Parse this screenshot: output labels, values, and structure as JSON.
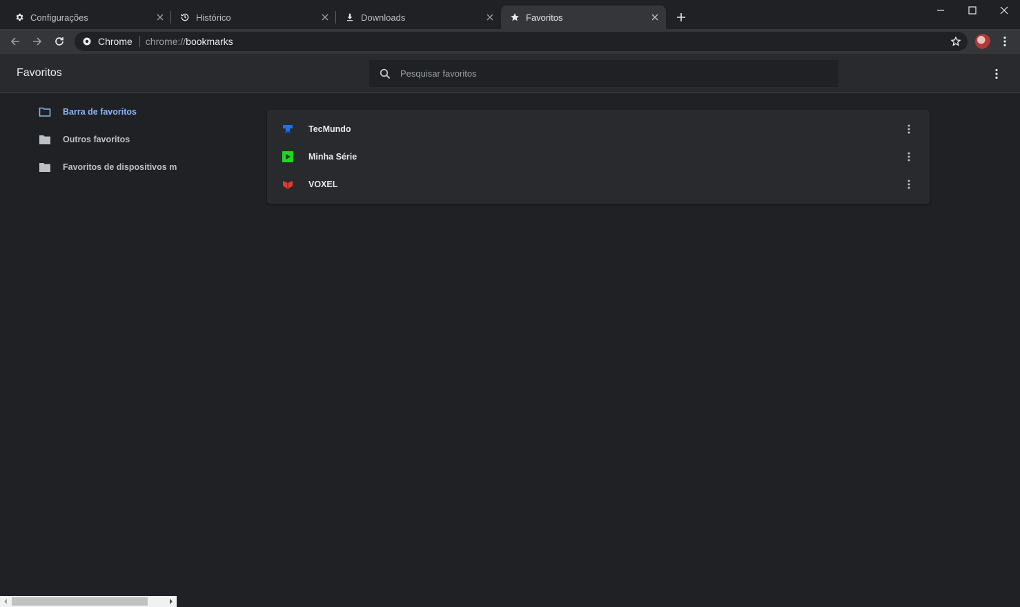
{
  "tabs": [
    {
      "title": "Configurações",
      "icon": "gear-icon",
      "active": false
    },
    {
      "title": "Histórico",
      "icon": "history-icon",
      "active": false
    },
    {
      "title": "Downloads",
      "icon": "download-icon",
      "active": false
    },
    {
      "title": "Favoritos",
      "icon": "star-icon",
      "active": true
    }
  ],
  "omnibox": {
    "site_label": "Chrome",
    "url_scheme": "chrome://",
    "url_host": "bookmarks"
  },
  "bookmarks_page": {
    "title": "Favoritos",
    "search_placeholder": "Pesquisar favoritos"
  },
  "sidebar": {
    "items": [
      {
        "label": "Barra de favoritos",
        "selected": true,
        "icon": "folder-open-icon"
      },
      {
        "label": "Outros favoritos",
        "selected": false,
        "icon": "folder-icon"
      },
      {
        "label": "Favoritos de dispositivos móveis",
        "selected": false,
        "icon": "folder-icon"
      }
    ]
  },
  "bookmarks": [
    {
      "label": "TecMundo",
      "icon": "tecmundo-favicon",
      "color": "#1a73e8"
    },
    {
      "label": "Minha Série",
      "icon": "minhaserie-favicon",
      "color": "#1ed81e"
    },
    {
      "label": "VOXEL",
      "icon": "voxel-favicon",
      "color": "#e53935"
    }
  ],
  "colors": {
    "background": "#202124",
    "toolbar": "#35363a",
    "accent": "#8ab4f8"
  }
}
